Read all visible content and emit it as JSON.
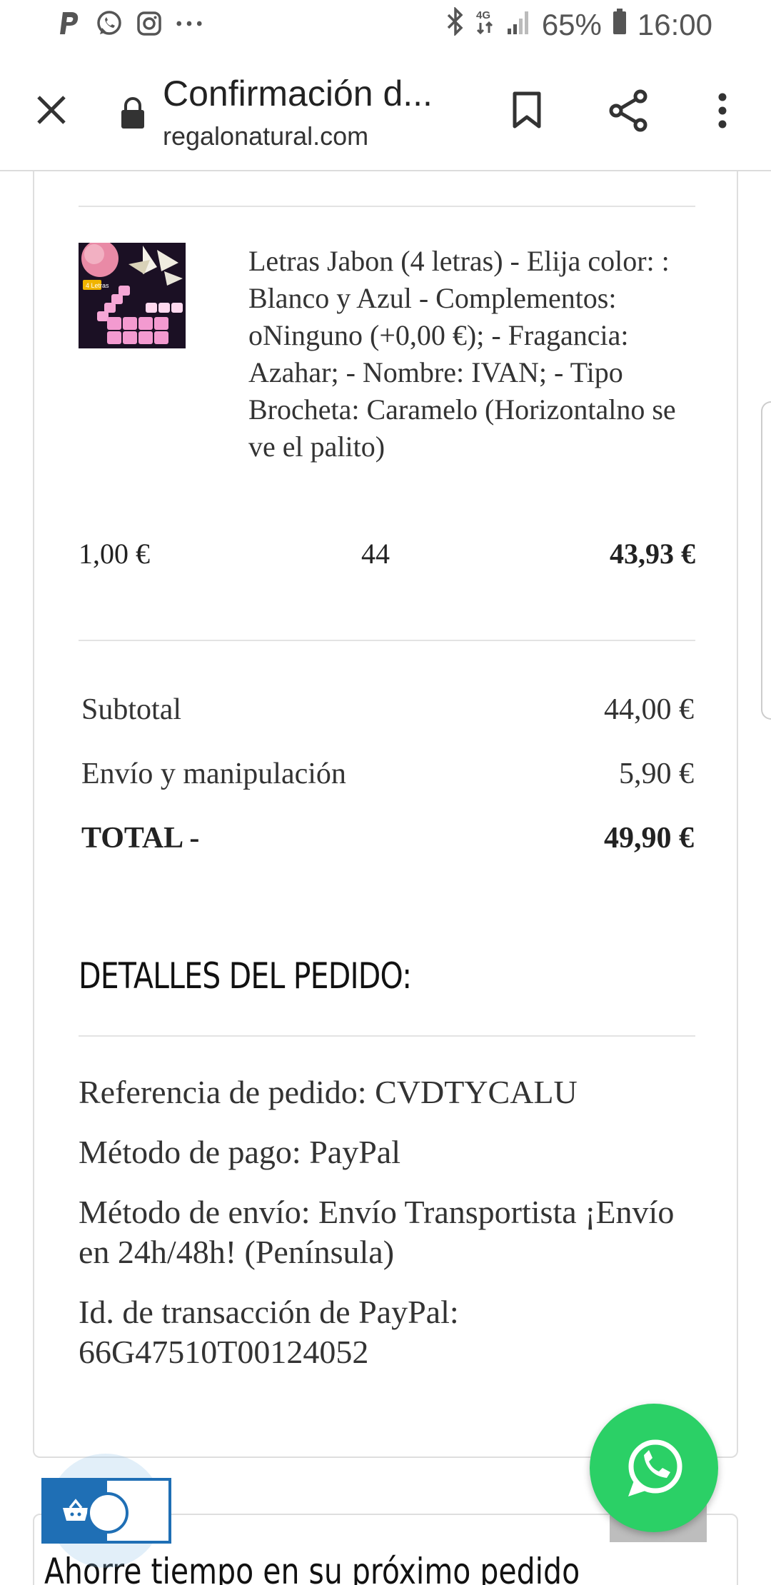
{
  "status_bar": {
    "battery": "65%",
    "network": "4G",
    "time": "16:00",
    "left_icons": [
      "paypal-icon",
      "whatsapp-icon",
      "instagram-icon",
      "more-dots-icon"
    ],
    "right_icons": [
      "bluetooth-icon",
      "data-arrows-icon",
      "signal-icon",
      "battery-icon"
    ]
  },
  "browser": {
    "title": "Confirmación d...",
    "url": "regalonatural.com"
  },
  "product": {
    "thumbnail_label": "4 Letras",
    "description": "Letras Jabon (4 letras) - Elija color: : Blanco y Azul - Complementos: oNinguno (+0,00 €); - Fragancia: Azahar; - Nombre: IVAN; - Tipo Brocheta: Caramelo (Horizontalno se ve el palito)",
    "unit_price": "1,00 €",
    "quantity": "44",
    "line_total": "43,93 €"
  },
  "summary": {
    "subtotal_label": "Subtotal",
    "subtotal_value": "44,00 €",
    "shipping_label": "Envío y manipulación",
    "shipping_value": "5,90 €",
    "total_label": "TOTAL -",
    "total_value": "49,90 €"
  },
  "details": {
    "heading": "DETALLES DEL PEDIDO:",
    "reference": "Referencia de pedido: CVDTYCALU",
    "payment": "Método de pago: PayPal",
    "shipping_method": "Método de envío: Envío Transportista ¡Envío en 24h/48h! (Península)",
    "transaction": "Id. de transacción de PayPal: 66G47510T00124052"
  },
  "next_section": {
    "heading": "Ahorre tiempo en su próximo pedido"
  },
  "colors": {
    "whatsapp_green": "#2bd066",
    "cart_blue": "#1f6fb5",
    "divider": "#e3e3e3"
  }
}
